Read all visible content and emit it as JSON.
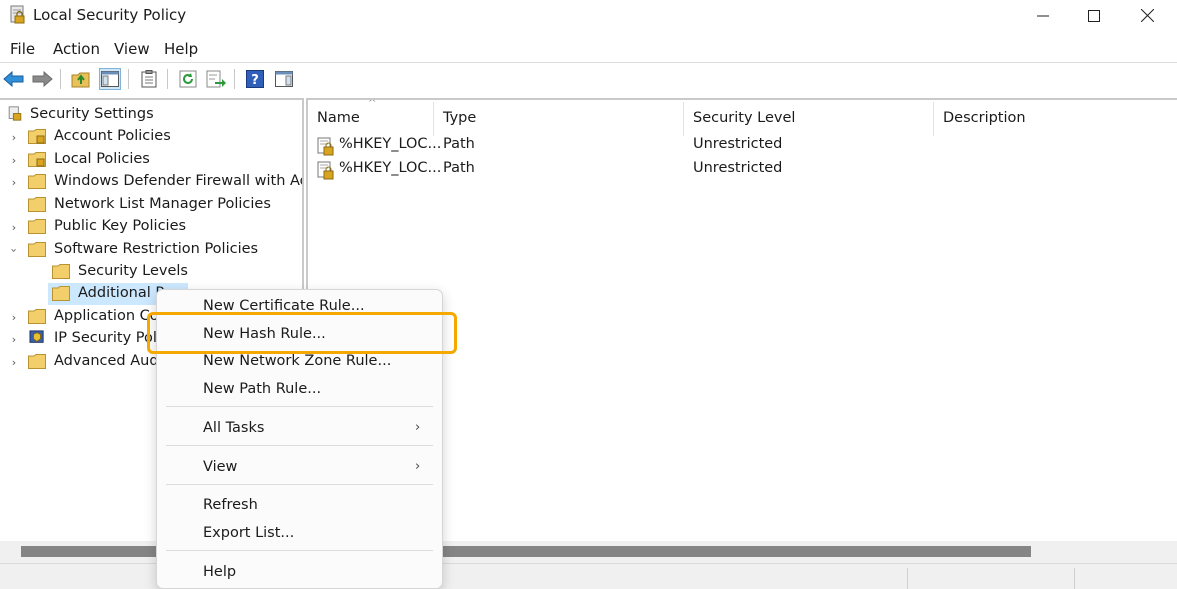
{
  "window": {
    "title": "Local Security Policy"
  },
  "menubar": {
    "items": [
      "File",
      "Action",
      "View",
      "Help"
    ]
  },
  "toolbar": {
    "icons": [
      "back-arrow-icon",
      "forward-arrow-icon",
      "up-folder-icon",
      "show-hide-tree-icon",
      "properties-icon",
      "refresh-icon",
      "export-list-icon",
      "help-icon",
      "show-hide-action-pane-icon"
    ]
  },
  "tree": {
    "root": "Security Settings",
    "items": [
      {
        "label": "Account Policies"
      },
      {
        "label": "Local Policies"
      },
      {
        "label": "Windows Defender Firewall with Advar"
      },
      {
        "label": "Network List Manager Policies"
      },
      {
        "label": "Public Key Policies"
      },
      {
        "label": "Software Restriction Policies"
      },
      {
        "label": "Security Levels"
      },
      {
        "label": "Additional Ru"
      },
      {
        "label": "Application Co"
      },
      {
        "label": "IP Security Poli"
      },
      {
        "label": "Advanced Audit"
      }
    ]
  },
  "list": {
    "columns": [
      "Name",
      "Type",
      "Security Level",
      "Description"
    ],
    "rows": [
      {
        "name": "%HKEY_LOC...",
        "type": "Path",
        "level": "Unrestricted",
        "description": ""
      },
      {
        "name": "%HKEY_LOC...",
        "type": "Path",
        "level": "Unrestricted",
        "description": ""
      }
    ]
  },
  "context_menu": {
    "items": {
      "new_certificate_rule": "New Certificate Rule...",
      "new_hash_rule": "New Hash Rule...",
      "new_network_zone_rule": "New Network Zone Rule...",
      "new_path_rule": "New Path Rule...",
      "all_tasks": "All Tasks",
      "view": "View",
      "refresh": "Refresh",
      "export_list": "Export List...",
      "help": "Help"
    },
    "highlight_color": "#f5a800"
  }
}
